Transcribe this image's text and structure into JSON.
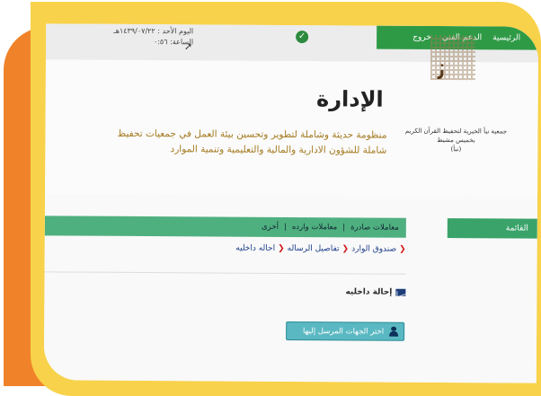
{
  "nav": {
    "home": "الرئيسية",
    "tech_support": "الدعم الفني",
    "logout": "خروج"
  },
  "header": {
    "date_line": "اليوم الأحد : ١٤٣٩/٠٧/٢٢هـ",
    "time_line": "الساعة: ٠:٥٦"
  },
  "hero": {
    "title": "الإدارة",
    "desc_line1": "منظومة حديثة وشاملة لتطوير وتحسين بيئة العمل في جمعيات تحفيظ",
    "desc_line2": "شاملة للشؤون الادارية والمالية والتعليمية وتنمية الموارد",
    "org_line1": "جمعية نبأ الخيرية لتحفيظ القرآن الكريم بخميس مشيط",
    "org_line2": "(نبأ)"
  },
  "sidebar": {
    "menu_label": "القائمة"
  },
  "tabs": [
    {
      "label": "معاملات صادرة"
    },
    {
      "label": "معاملات وارده"
    },
    {
      "label": "أخرى"
    }
  ],
  "breadcrumb": [
    {
      "label": "صندوق الوارد"
    },
    {
      "label": "تفاصيل الرساله"
    },
    {
      "label": "احاله داخليه"
    }
  ],
  "content": {
    "internal_referral": "إحالة داخليه",
    "select_recipients": "اختر الجهات المرسل إليها"
  },
  "colors": {
    "accent_green": "#2f9a46",
    "tab_green": "#4fb07f",
    "frame_yellow": "#f8d24a",
    "frame_orange": "#f0832a",
    "button_teal": "#5ab8c2",
    "breadcrumb_arrow": "#d21a1a"
  },
  "icons": [
    "check-circle-icon",
    "cursor-icon",
    "envelope-icon",
    "user-icon",
    "chevron-left-icon"
  ]
}
